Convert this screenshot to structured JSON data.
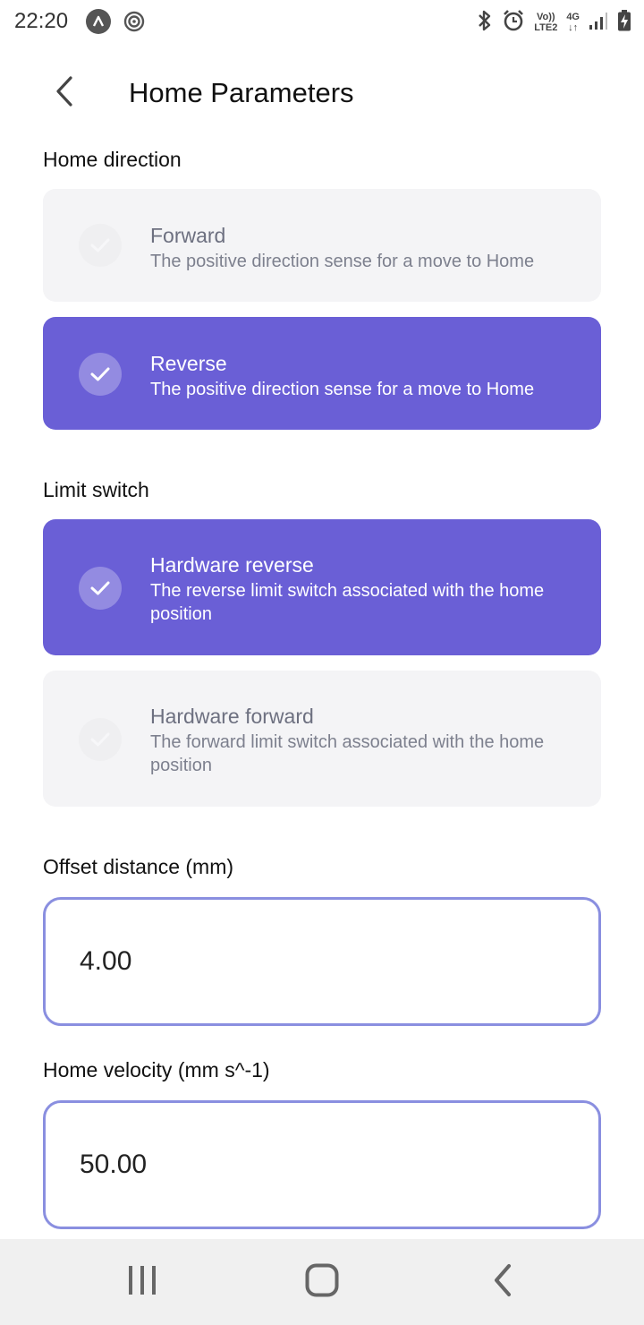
{
  "status_bar": {
    "time": "22:20",
    "volte_top": "Vo))",
    "volte_bottom": "LTE2",
    "network": "4G",
    "icons": [
      "app-a-icon",
      "hotspot-icon",
      "bluetooth-icon",
      "alarm-icon",
      "volte-icon",
      "data-4g-icon",
      "signal-icon",
      "battery-charging-icon"
    ]
  },
  "header": {
    "title": "Home Parameters",
    "back_icon": "chevron-left-icon"
  },
  "home_direction": {
    "label": "Home direction",
    "options": [
      {
        "title": "Forward",
        "description": "The positive direction sense for a move to Home",
        "selected": false
      },
      {
        "title": "Reverse",
        "description": "The positive direction sense for a move to Home",
        "selected": true
      }
    ]
  },
  "limit_switch": {
    "label": "Limit switch",
    "options": [
      {
        "title": "Hardware reverse",
        "description": "The reverse limit switch associated with the home position",
        "selected": true
      },
      {
        "title": "Hardware forward",
        "description": "The forward limit switch associated with the home position",
        "selected": false
      }
    ]
  },
  "offset_distance": {
    "label": "Offset distance (mm)",
    "value": "4.00"
  },
  "home_velocity": {
    "label": "Home velocity (mm s^-1)",
    "value": "50.00"
  },
  "nav_bar": {
    "icons": [
      "recent-apps-icon",
      "home-icon",
      "back-icon"
    ]
  },
  "colors": {
    "accent": "#6a5fd6",
    "input_border": "#8a8fe0",
    "card_unselected": "#f4f4f6"
  }
}
